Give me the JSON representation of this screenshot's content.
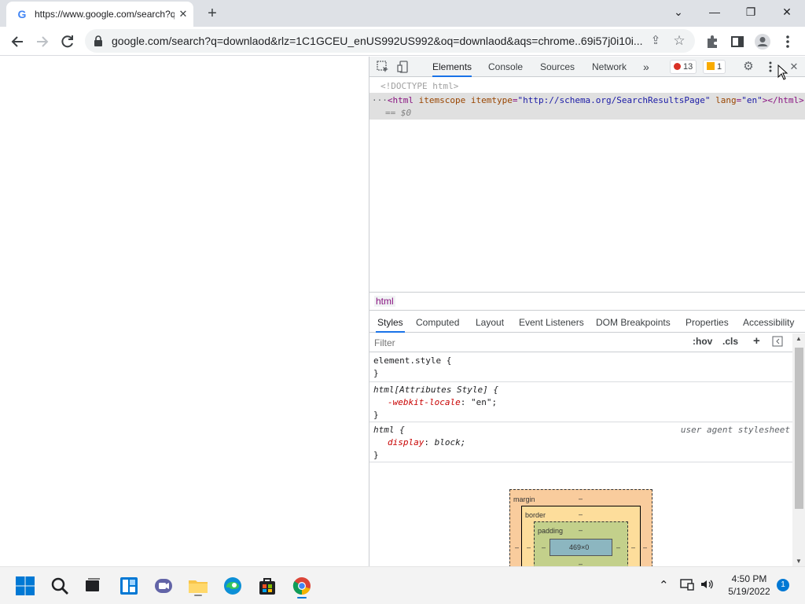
{
  "browser": {
    "tab_title": "https://www.google.com/search?q=downlaod",
    "tab_favicon": "G",
    "new_tab_label": "+",
    "url": "google.com/search?q=downlaod&rlz=1C1GCEU_enUS992US992&oq=downlaod&aqs=chrome..69i57j0i10i...",
    "window": {
      "minimize": "—",
      "maximize": "❐",
      "close": "✕",
      "tab_search": "⌄"
    }
  },
  "devtools": {
    "tabs": [
      "Elements",
      "Console",
      "Sources",
      "Network"
    ],
    "more_tabs": "»",
    "errors": "13",
    "warnings": "1",
    "dom": {
      "doctype": "<!DOCTYPE html>",
      "ellipsis": "···",
      "tag_open": "<html",
      "attr1": "itemscope",
      "attr2": "itemtype",
      "attr2_val": "\"http://schema.org/SearchResultsPage\"",
      "attr3": "lang",
      "attr3_val": "\"en\"",
      "tag_close": "></html>",
      "eq": "== $0"
    },
    "breadcrumb": "html",
    "sub_tabs": [
      "Styles",
      "Computed",
      "Layout",
      "Event Listeners",
      "DOM Breakpoints",
      "Properties",
      "Accessibility"
    ],
    "filter_placeholder": "Filter",
    "filter_hov": ":hov",
    "filter_cls": ".cls",
    "filter_plus": "+",
    "styles": {
      "rule1_selector": "element.style {",
      "rule1_close": "}",
      "rule2_selector": "html[Attributes Style] {",
      "rule2_prop": "-webkit-locale",
      "rule2_val": "\"en\";",
      "rule2_close": "}",
      "rule3_selector": "html {",
      "rule3_source": "user agent stylesheet",
      "rule3_prop": "display",
      "rule3_val": "block;",
      "rule3_close": "}"
    },
    "box_model": {
      "margin_label": "margin",
      "border_label": "border",
      "padding_label": "padding",
      "dash": "–",
      "content_size": "469×0"
    }
  },
  "taskbar": {
    "time": "4:50 PM",
    "date": "5/19/2022",
    "notifications": "1"
  },
  "colors": {
    "accent": "#1a73e8",
    "margin_box": "#f9cc9d",
    "border_box": "#fddd9b",
    "padding_box": "#c3d08b",
    "content_box": "#8cb6c0"
  }
}
